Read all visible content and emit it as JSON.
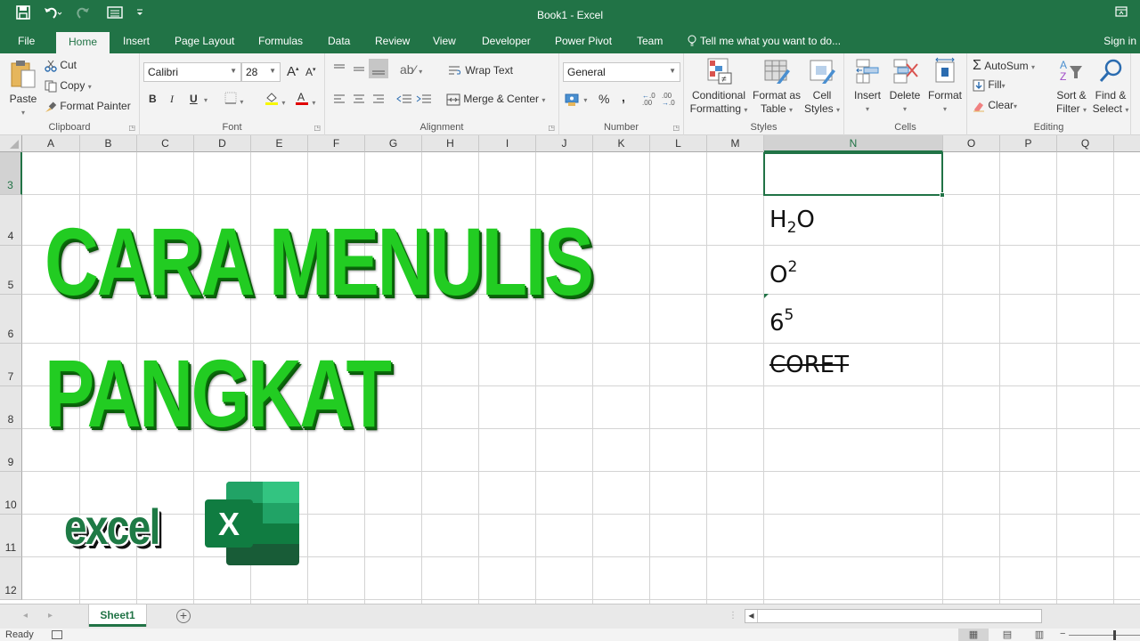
{
  "titlebar": {
    "title": "Book1 - Excel",
    "qat": {
      "save_icon": "💾",
      "undo_icon": "↶",
      "redo_icon": "↷",
      "form_icon": "☰",
      "customize_icon": "⌄"
    },
    "ribbon_display_icon": "⊡",
    "minimize_icon": "—"
  },
  "tabs": {
    "file": "File",
    "items": [
      "Home",
      "Insert",
      "Page Layout",
      "Formulas",
      "Data",
      "Review",
      "View",
      "Developer",
      "Power Pivot",
      "Team"
    ],
    "active": "Home",
    "tell_me": "Tell me what you want to do...",
    "tell_me_icon": "💡",
    "sign_in": "Sign in"
  },
  "ribbon": {
    "clipboard": {
      "label": "Clipboard",
      "paste": "Paste",
      "cut": "Cut",
      "copy": "Copy",
      "format_painter": "Format Painter"
    },
    "font": {
      "label": "Font",
      "font_name": "Calibri",
      "font_size": "28",
      "grow": "A",
      "shrink": "A",
      "bold": "B",
      "italic": "I",
      "underline": "U",
      "fill_color": "#f7f700",
      "font_color": "#e00000"
    },
    "alignment": {
      "label": "Alignment",
      "wrap_text": "Wrap Text",
      "merge_center": "Merge & Center"
    },
    "number": {
      "label": "Number",
      "format": "General",
      "percent": "%",
      "comma": ",",
      "inc_decimal": "←.0 .00",
      "dec_decimal": ".00 →.0"
    },
    "styles": {
      "label": "Styles",
      "conditional_formatting": [
        "Conditional",
        "Formatting"
      ],
      "format_as_table": [
        "Format as",
        "Table"
      ],
      "cell_styles": [
        "Cell",
        "Styles"
      ]
    },
    "cells": {
      "label": "Cells",
      "insert": "Insert",
      "delete": "Delete",
      "format": "Format"
    },
    "editing": {
      "label": "Editing",
      "autosum": "AutoSum",
      "fill": "Fill",
      "clear": "Clear",
      "sort_filter": [
        "Sort &",
        "Filter"
      ],
      "find_select": [
        "Find &",
        "Select"
      ]
    }
  },
  "grid": {
    "columns": [
      "A",
      "B",
      "C",
      "D",
      "E",
      "F",
      "G",
      "H",
      "I",
      "J",
      "K",
      "L",
      "M",
      "N",
      "O",
      "P",
      "Q"
    ],
    "rows": [
      "3",
      "4",
      "5",
      "6",
      "7",
      "8",
      "9",
      "10",
      "11",
      "12"
    ],
    "selected_cell": "N3",
    "cells": {
      "N4": {
        "base": "H",
        "sub": "2",
        "after": "O"
      },
      "N5": {
        "base": "O",
        "sup": "2"
      },
      "N6": {
        "base": "6",
        "sup": "5"
      },
      "N7": {
        "text": "CORET",
        "strikethrough": true
      }
    }
  },
  "overlay": {
    "title_line1": "CARA MENULIS",
    "title_line2": "PANGKAT",
    "title_color": "#22cc22",
    "excel_word": "excel",
    "excel_logo_letter": "X"
  },
  "sheets": {
    "tabs": [
      "Sheet1"
    ],
    "active": "Sheet1",
    "add_icon": "+"
  },
  "status": {
    "ready": "Ready"
  },
  "colors": {
    "brand": "#217346"
  }
}
